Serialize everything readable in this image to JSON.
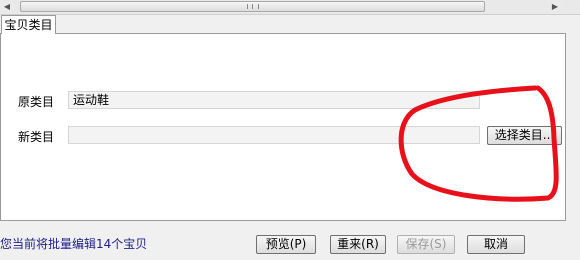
{
  "tab": {
    "label": "宝贝类目"
  },
  "form": {
    "original_label": "原类目",
    "original_value": "运动鞋",
    "new_label": "新类目",
    "new_value": "",
    "select_button": "选择类目..."
  },
  "status": {
    "text": "您当前将批量编辑14个宝贝"
  },
  "buttons": {
    "preview": "预览(P)",
    "reset": "重来(R)",
    "save": "保存(S)",
    "cancel": "取消"
  },
  "colors": {
    "annotation": "#e8101a",
    "status_text": "#20208a"
  }
}
